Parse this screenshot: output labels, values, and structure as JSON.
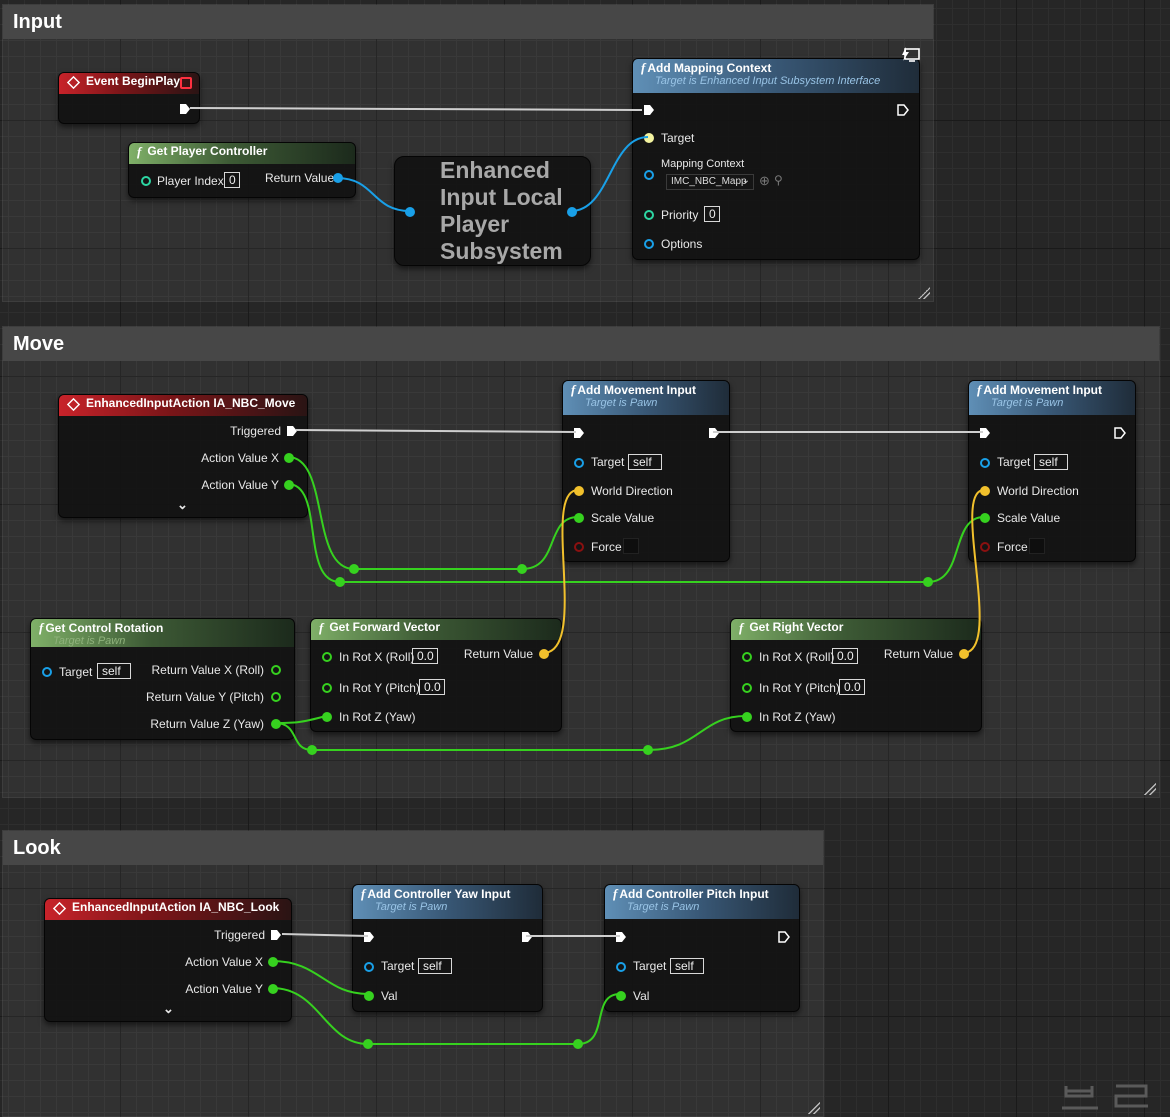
{
  "comments": {
    "input": "Input",
    "move": "Move",
    "look": "Look"
  },
  "input": {
    "begin_play": "Event BeginPlay",
    "get_pc": {
      "title": "Get Player Controller",
      "player_index": "Player Index",
      "player_index_value": "0",
      "return_value": "Return Value"
    },
    "subsystem": [
      "Enhanced",
      "Input Local",
      "Player",
      "Subsystem"
    ],
    "add_mapping": {
      "title": "Add Mapping Context",
      "subtitle": "Target is Enhanced Input Subsystem Interface",
      "target": "Target",
      "mapping_context": "Mapping Context",
      "mapping_value": "IMC_NBC_Mapp",
      "priority": "Priority",
      "priority_value": "0",
      "options": "Options"
    }
  },
  "move": {
    "event": {
      "title": "EnhancedInputAction IA_NBC_Move",
      "triggered": "Triggered",
      "action_x": "Action Value X",
      "action_y": "Action Value Y"
    },
    "add_move_1": {
      "title": "Add Movement Input",
      "subtitle": "Target is Pawn",
      "target": "Target",
      "target_value": "self",
      "world_direction": "World Direction",
      "scale_value": "Scale Value",
      "force": "Force"
    },
    "add_move_2": {
      "title": "Add Movement Input",
      "subtitle": "Target is Pawn",
      "target": "Target",
      "target_value": "self",
      "world_direction": "World Direction",
      "scale_value": "Scale Value",
      "force": "Force"
    },
    "get_rot": {
      "title": "Get Control Rotation",
      "subtitle": "Target is Pawn",
      "target": "Target",
      "target_value": "self",
      "rx": "Return Value X (Roll)",
      "ry": "Return Value Y (Pitch)",
      "rz": "Return Value Z (Yaw)"
    },
    "fwd": {
      "title": "Get Forward Vector",
      "in_x": "In Rot X (Roll)",
      "in_x_value": "0.0",
      "in_y": "In Rot Y (Pitch)",
      "in_y_value": "0.0",
      "in_z": "In Rot Z (Yaw)",
      "return_value": "Return Value"
    },
    "right": {
      "title": "Get Right Vector",
      "in_x": "In Rot X (Roll)",
      "in_x_value": "0.0",
      "in_y": "In Rot Y (Pitch)",
      "in_y_value": "0.0",
      "in_z": "In Rot Z (Yaw)",
      "return_value": "Return Value"
    }
  },
  "look": {
    "event": {
      "title": "EnhancedInputAction IA_NBC_Look",
      "triggered": "Triggered",
      "action_x": "Action Value X",
      "action_y": "Action Value Y"
    },
    "yaw": {
      "title": "Add Controller Yaw Input",
      "subtitle": "Target is Pawn",
      "target": "Target",
      "target_value": "self",
      "val": "Val"
    },
    "pitch": {
      "title": "Add Controller Pitch Input",
      "subtitle": "Target is Pawn",
      "target": "Target",
      "target_value": "self",
      "val": "Val"
    }
  },
  "colors": {
    "exec": "#ffffff",
    "float": "#36d11f",
    "vector": "#f1c02c",
    "object": "#19a0e8",
    "bool": "#8a1010"
  }
}
